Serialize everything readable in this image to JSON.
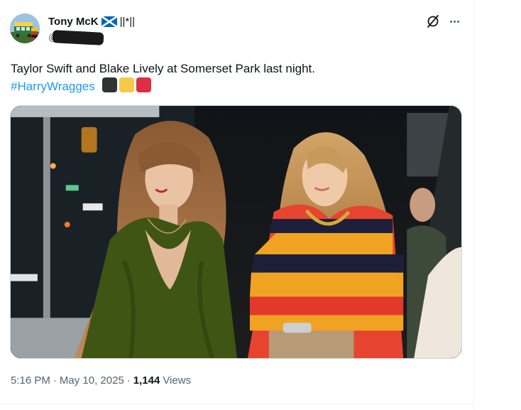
{
  "author": {
    "display_name": "Tony McK",
    "name_suffix": "||*||",
    "flag": "scotland-flag",
    "handle": "@T"
  },
  "icons": {
    "grok": "grok-icon",
    "more": "more-icon"
  },
  "tweet": {
    "text": "Taylor Swift and Blake Lively at Somerset Park last night.",
    "hashtag": "#HarryWragges",
    "emoji_colors": [
      "#2f3336",
      "#f7c948",
      "#dd2e44"
    ]
  },
  "meta": {
    "time": "5:16 PM",
    "separator1": "·",
    "date": "May 10, 2025",
    "separator2": "·",
    "views_count": "1,144",
    "views_label": "Views"
  },
  "colors": {
    "link": "#1d9bf0",
    "secondary_text": "#536471",
    "divider": "#eff3f4"
  }
}
